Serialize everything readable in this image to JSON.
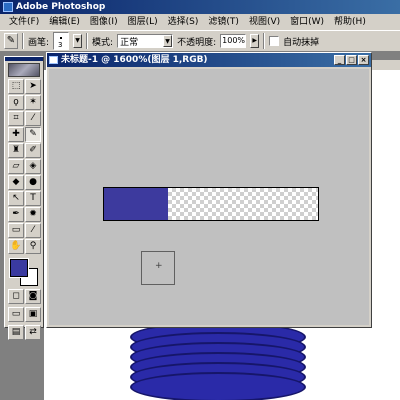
{
  "app": {
    "title": "Adobe Photoshop"
  },
  "menu": [
    {
      "label": "文件(F)"
    },
    {
      "label": "编辑(E)"
    },
    {
      "label": "图像(I)"
    },
    {
      "label": "图层(L)"
    },
    {
      "label": "选择(S)"
    },
    {
      "label": "滤镜(T)"
    },
    {
      "label": "视图(V)"
    },
    {
      "label": "窗口(W)"
    },
    {
      "label": "帮助(H)"
    }
  ],
  "options_bar": {
    "tool_icon": "pencil-icon",
    "brush_label": "画笔:",
    "brush_size": "3",
    "mode_label": "模式:",
    "mode_value": "正常",
    "opacity_label": "不透明度:",
    "opacity_value": "100%",
    "auto_erase_label": "自动抹掉",
    "auto_erase_checked": false
  },
  "document": {
    "title": "未标题-1 @ 1600%(图层 1,RGB)"
  },
  "colors": {
    "foreground": "#3a3aa0",
    "background": "#ffffff",
    "layer_fill": "#3d3a9e",
    "disc": "#2a2aa8"
  },
  "layer_strip": {
    "filled_fraction": 0.3
  },
  "toolbox": {
    "tools": [
      "marquee-icon",
      "move-icon",
      "lasso-icon",
      "magic-wand-icon",
      "crop-icon",
      "slice-icon",
      "healing-brush-icon",
      "pencil-icon",
      "clone-stamp-icon",
      "history-brush-icon",
      "eraser-icon",
      "paint-bucket-icon",
      "blur-icon",
      "dodge-icon",
      "path-select-icon",
      "type-icon",
      "pen-icon",
      "custom-shape-icon",
      "notes-icon",
      "eyedropper-icon",
      "hand-icon",
      "zoom-icon"
    ]
  }
}
